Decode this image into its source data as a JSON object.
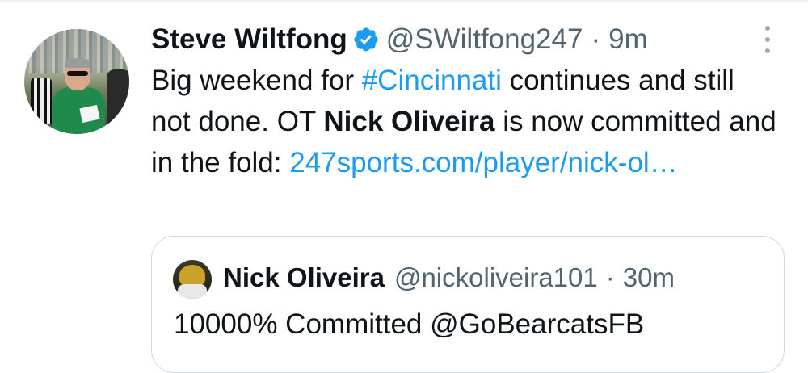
{
  "tweet": {
    "author_name": "Steve Wiltfong",
    "author_handle": "@SWiltfong247",
    "separator": "·",
    "time": "9m",
    "text_segments": [
      {
        "text": "Big weekend for ",
        "style": "plain"
      },
      {
        "text": "#Cincinnati",
        "style": "link"
      },
      {
        "text": " continues and still not done. OT ",
        "style": "plain"
      },
      {
        "text": "Nick Oliveira",
        "style": "bold"
      },
      {
        "text": " is now committed and in the fold: ",
        "style": "plain"
      },
      {
        "text": "247sports.com/player/nick-ol…",
        "style": "link"
      }
    ]
  },
  "quoted_tweet": {
    "author_name": "Nick Oliveira",
    "author_handle": "@nickoliveira101",
    "separator": "·",
    "time": "30m",
    "text": "10000% Committed @GoBearcatsFB"
  },
  "icons": {
    "verified": "verified-badge-icon",
    "more": "more-options-icon"
  },
  "colors": {
    "link": "#1d9bf0",
    "muted": "#536471",
    "text": "#0f1419",
    "border": "#cfd9de"
  }
}
